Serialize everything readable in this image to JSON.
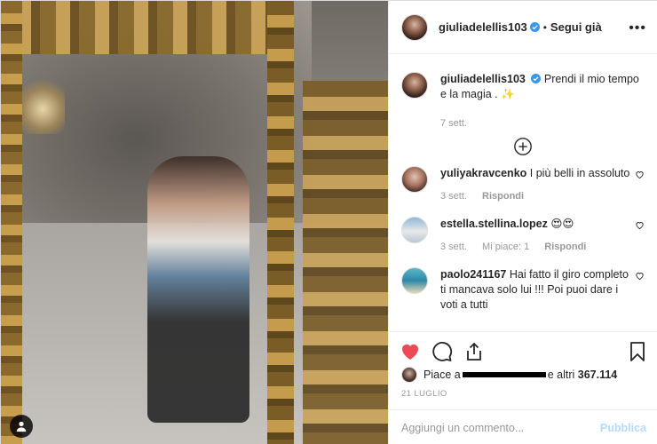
{
  "post": {
    "author": "giulia.delellis103",
    "author_display": "giuliadelellis103",
    "follow_status": "Segui già",
    "caption": "Prendi il mio tempo e la magia .",
    "caption_emoji": "✨",
    "caption_time": "7 sett."
  },
  "comments": [
    {
      "user": "yuliyakravcenko",
      "text": "I più belli in assoluto",
      "time": "3 sett.",
      "likes": "",
      "reply": "Rispondi"
    },
    {
      "user": "estella.stellina.lopez",
      "text": "😍😍",
      "time": "3 sett.",
      "likes": "Mi piace: 1",
      "reply": "Rispondi"
    },
    {
      "user": "paolo241167",
      "text": "Hai fatto il giro completo ti mancava solo lui !!! Poi puoi dare i voti a tutti",
      "time": "",
      "likes": "",
      "reply": ""
    }
  ],
  "likes": {
    "prefix": "Piace a",
    "suffix": "e altri",
    "count": "367.114"
  },
  "date": "21 LUGLIO",
  "add_comment": {
    "placeholder": "Aggiungi un commento...",
    "publish_label": "Pubblica"
  },
  "colors": {
    "like_red": "#ed4956",
    "verified_blue": "#3897f0",
    "publish_disabled": "#b3dbff"
  },
  "icons": {
    "more": "more-options-icon",
    "verified": "verified-badge-icon",
    "load_more": "plus-circle-icon",
    "like": "heart-filled-icon",
    "comment": "comment-bubble-icon",
    "share": "share-upload-icon",
    "save": "bookmark-icon",
    "user_tag": "user-tag-icon"
  }
}
